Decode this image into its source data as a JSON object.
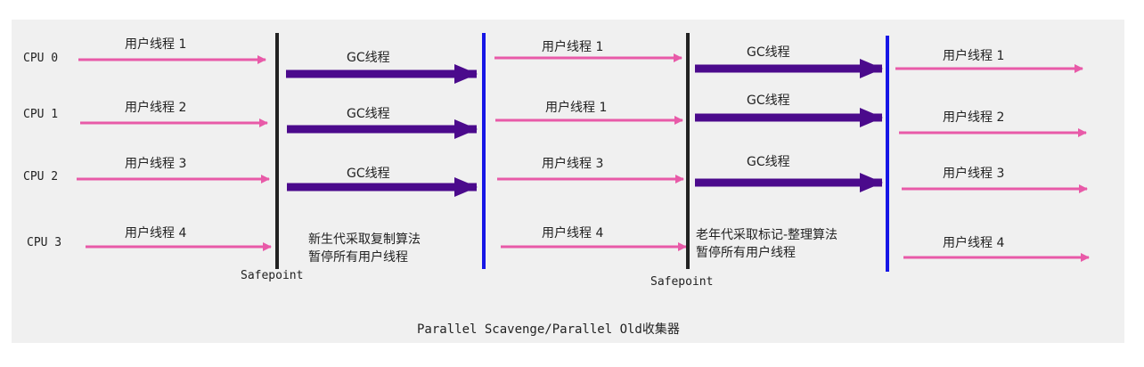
{
  "cpus": [
    "CPU 0",
    "CPU 1",
    "CPU 2",
    "CPU 3"
  ],
  "phase1_user_threads": [
    "用户线程 1",
    "用户线程 2",
    "用户线程 3",
    "用户线程 4"
  ],
  "phase2_gc_threads": [
    "GC线程",
    "GC线程",
    "GC线程"
  ],
  "phase2_note": [
    "新生代采取复制算法",
    "暂停所有用户线程"
  ],
  "phase3_user_threads": [
    "用户线程 1",
    "用户线程 1",
    "用户线程 3",
    "用户线程 4"
  ],
  "phase4_gc_threads": [
    "GC线程",
    "GC线程",
    "GC线程"
  ],
  "phase4_note": [
    "老年代采取标记-整理算法",
    "暂停所有用户线程"
  ],
  "phase5_user_threads": [
    "用户线程 1",
    "用户线程 2",
    "用户线程 3",
    "用户线程 4"
  ],
  "safepoint_label_1": "Safepoint",
  "safepoint_label_2": "Safepoint",
  "caption": "Parallel Scavenge/Parallel Old收集器",
  "colors": {
    "user_arrow": "#e85aa8",
    "gc_arrow": "#4b0a8c",
    "safepoint_line": "#222222",
    "divider_line": "#1616e6",
    "panel_bg": "#f0f0f0"
  }
}
